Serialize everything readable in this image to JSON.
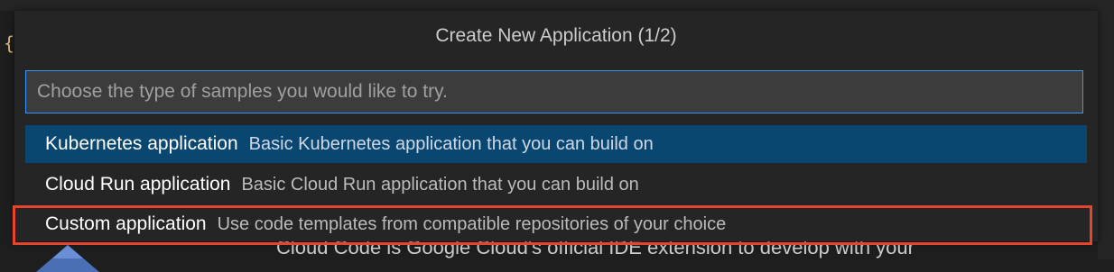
{
  "quick_pick": {
    "title": "Create New Application (1/2)",
    "input": {
      "value": "",
      "placeholder": "Choose the type of samples you would like to try."
    },
    "items": [
      {
        "label": "Kubernetes application",
        "description": "Basic Kubernetes application that you can build on",
        "selected": true
      },
      {
        "label": "Cloud Run application",
        "description": "Basic Cloud Run application that you can build on",
        "selected": false
      },
      {
        "label": "Custom application",
        "description": "Use code templates from compatible repositories of your choice",
        "selected": false,
        "highlighted": true
      }
    ]
  },
  "background": {
    "editor_glyph": "{",
    "body_text": "Cloud Code is Google Cloud's official IDE extension to develop with your"
  },
  "colors": {
    "selection": "#094771",
    "focus_border": "#3794ff",
    "highlight_annotation": "#e8432e"
  },
  "icons": {
    "logo": "cloud-code-logo-icon"
  }
}
